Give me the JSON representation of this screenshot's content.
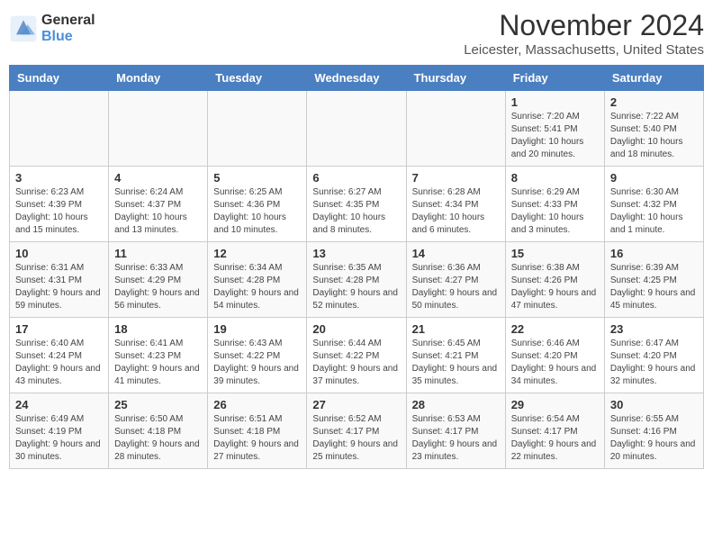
{
  "logo": {
    "general": "General",
    "blue": "Blue"
  },
  "title": "November 2024",
  "location": "Leicester, Massachusetts, United States",
  "days_of_week": [
    "Sunday",
    "Monday",
    "Tuesday",
    "Wednesday",
    "Thursday",
    "Friday",
    "Saturday"
  ],
  "weeks": [
    [
      {
        "day": "",
        "detail": ""
      },
      {
        "day": "",
        "detail": ""
      },
      {
        "day": "",
        "detail": ""
      },
      {
        "day": "",
        "detail": ""
      },
      {
        "day": "",
        "detail": ""
      },
      {
        "day": "1",
        "detail": "Sunrise: 7:20 AM\nSunset: 5:41 PM\nDaylight: 10 hours and 20 minutes."
      },
      {
        "day": "2",
        "detail": "Sunrise: 7:22 AM\nSunset: 5:40 PM\nDaylight: 10 hours and 18 minutes."
      }
    ],
    [
      {
        "day": "3",
        "detail": "Sunrise: 6:23 AM\nSunset: 4:39 PM\nDaylight: 10 hours and 15 minutes."
      },
      {
        "day": "4",
        "detail": "Sunrise: 6:24 AM\nSunset: 4:37 PM\nDaylight: 10 hours and 13 minutes."
      },
      {
        "day": "5",
        "detail": "Sunrise: 6:25 AM\nSunset: 4:36 PM\nDaylight: 10 hours and 10 minutes."
      },
      {
        "day": "6",
        "detail": "Sunrise: 6:27 AM\nSunset: 4:35 PM\nDaylight: 10 hours and 8 minutes."
      },
      {
        "day": "7",
        "detail": "Sunrise: 6:28 AM\nSunset: 4:34 PM\nDaylight: 10 hours and 6 minutes."
      },
      {
        "day": "8",
        "detail": "Sunrise: 6:29 AM\nSunset: 4:33 PM\nDaylight: 10 hours and 3 minutes."
      },
      {
        "day": "9",
        "detail": "Sunrise: 6:30 AM\nSunset: 4:32 PM\nDaylight: 10 hours and 1 minute."
      }
    ],
    [
      {
        "day": "10",
        "detail": "Sunrise: 6:31 AM\nSunset: 4:31 PM\nDaylight: 9 hours and 59 minutes."
      },
      {
        "day": "11",
        "detail": "Sunrise: 6:33 AM\nSunset: 4:29 PM\nDaylight: 9 hours and 56 minutes."
      },
      {
        "day": "12",
        "detail": "Sunrise: 6:34 AM\nSunset: 4:28 PM\nDaylight: 9 hours and 54 minutes."
      },
      {
        "day": "13",
        "detail": "Sunrise: 6:35 AM\nSunset: 4:28 PM\nDaylight: 9 hours and 52 minutes."
      },
      {
        "day": "14",
        "detail": "Sunrise: 6:36 AM\nSunset: 4:27 PM\nDaylight: 9 hours and 50 minutes."
      },
      {
        "day": "15",
        "detail": "Sunrise: 6:38 AM\nSunset: 4:26 PM\nDaylight: 9 hours and 47 minutes."
      },
      {
        "day": "16",
        "detail": "Sunrise: 6:39 AM\nSunset: 4:25 PM\nDaylight: 9 hours and 45 minutes."
      }
    ],
    [
      {
        "day": "17",
        "detail": "Sunrise: 6:40 AM\nSunset: 4:24 PM\nDaylight: 9 hours and 43 minutes."
      },
      {
        "day": "18",
        "detail": "Sunrise: 6:41 AM\nSunset: 4:23 PM\nDaylight: 9 hours and 41 minutes."
      },
      {
        "day": "19",
        "detail": "Sunrise: 6:43 AM\nSunset: 4:22 PM\nDaylight: 9 hours and 39 minutes."
      },
      {
        "day": "20",
        "detail": "Sunrise: 6:44 AM\nSunset: 4:22 PM\nDaylight: 9 hours and 37 minutes."
      },
      {
        "day": "21",
        "detail": "Sunrise: 6:45 AM\nSunset: 4:21 PM\nDaylight: 9 hours and 35 minutes."
      },
      {
        "day": "22",
        "detail": "Sunrise: 6:46 AM\nSunset: 4:20 PM\nDaylight: 9 hours and 34 minutes."
      },
      {
        "day": "23",
        "detail": "Sunrise: 6:47 AM\nSunset: 4:20 PM\nDaylight: 9 hours and 32 minutes."
      }
    ],
    [
      {
        "day": "24",
        "detail": "Sunrise: 6:49 AM\nSunset: 4:19 PM\nDaylight: 9 hours and 30 minutes."
      },
      {
        "day": "25",
        "detail": "Sunrise: 6:50 AM\nSunset: 4:18 PM\nDaylight: 9 hours and 28 minutes."
      },
      {
        "day": "26",
        "detail": "Sunrise: 6:51 AM\nSunset: 4:18 PM\nDaylight: 9 hours and 27 minutes."
      },
      {
        "day": "27",
        "detail": "Sunrise: 6:52 AM\nSunset: 4:17 PM\nDaylight: 9 hours and 25 minutes."
      },
      {
        "day": "28",
        "detail": "Sunrise: 6:53 AM\nSunset: 4:17 PM\nDaylight: 9 hours and 23 minutes."
      },
      {
        "day": "29",
        "detail": "Sunrise: 6:54 AM\nSunset: 4:17 PM\nDaylight: 9 hours and 22 minutes."
      },
      {
        "day": "30",
        "detail": "Sunrise: 6:55 AM\nSunset: 4:16 PM\nDaylight: 9 hours and 20 minutes."
      }
    ]
  ]
}
